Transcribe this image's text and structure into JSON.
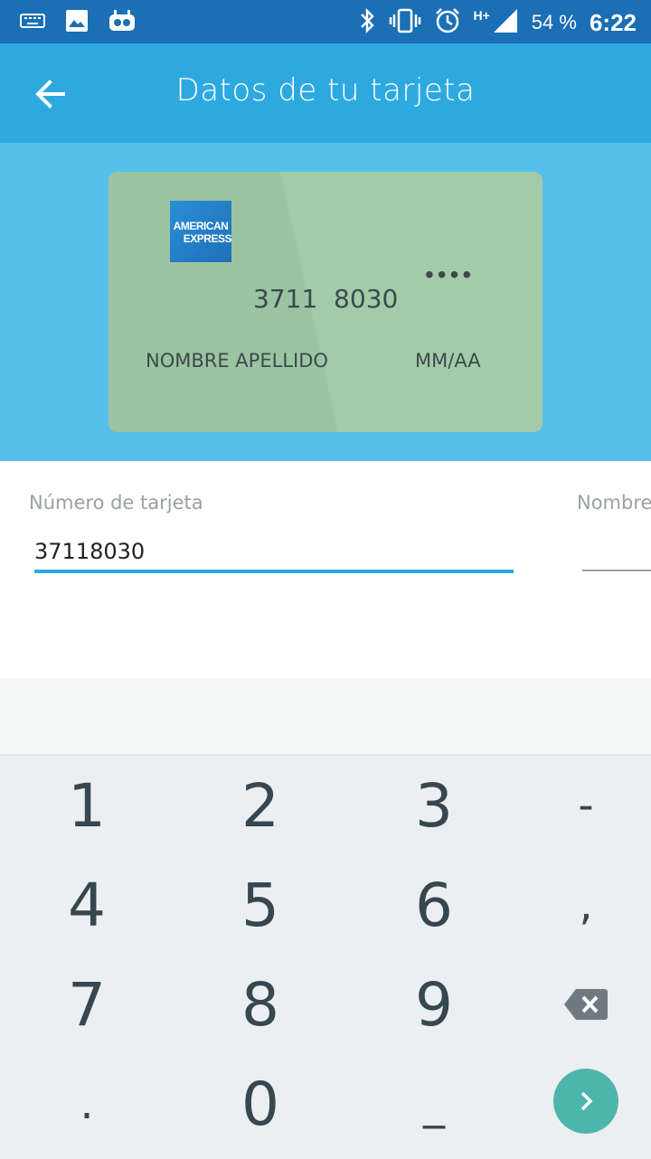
{
  "status_bar": {
    "icons_left": [
      "keyboard-icon",
      "image-icon",
      "cyanogen-bot-icon"
    ],
    "icons_right": [
      "bluetooth-icon",
      "vibrate-icon",
      "alarm-icon",
      "signal-icon"
    ],
    "network": "H+",
    "battery_percent": "54 %",
    "time": "6:22"
  },
  "appbar": {
    "title": "Datos de tu tarjeta",
    "back_icon": "arrow-left-icon"
  },
  "card_preview": {
    "brand_line1": "AMERICAN",
    "brand_line2": "EXPRESS",
    "masked_digits": "••••",
    "number": "3711  8030",
    "holder": "NOMBRE APELLIDO",
    "expiry": "MM/AA",
    "colors": {
      "card": "#a2cbaa",
      "hero": "#57c0ea",
      "appbar": "#2ea9e0"
    }
  },
  "form": {
    "number_label": "Número de tarjeta",
    "number_value": "37118030",
    "name_label": "Nombre"
  },
  "keypad": {
    "row1": [
      "1",
      "2",
      "3",
      "-"
    ],
    "row2": [
      "4",
      "5",
      "6",
      ","
    ],
    "row3": [
      "7",
      "8",
      "9"
    ],
    "row4": [
      ".",
      "0",
      "_"
    ],
    "backspace_icon": "backspace-icon",
    "next_icon": "chevron-right-icon",
    "accent": "#4db6ac"
  }
}
